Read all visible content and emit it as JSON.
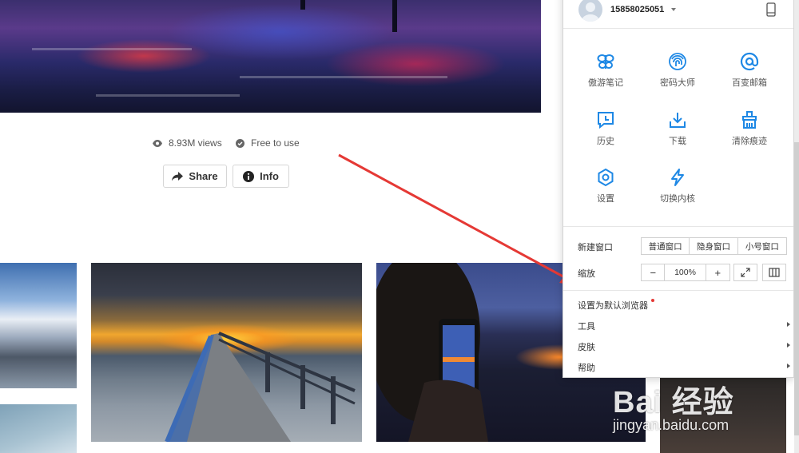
{
  "photo": {
    "views": "8.93M views",
    "license": "Free to use",
    "share_label": "Share",
    "info_label": "Info"
  },
  "browser_menu": {
    "username": "15858025051",
    "grid": [
      {
        "label": "傲游笔记",
        "icon": "butterfly-note-icon"
      },
      {
        "label": "密码大师",
        "icon": "fingerprint-icon"
      },
      {
        "label": "百变邮箱",
        "icon": "at-mail-icon"
      },
      {
        "label": "历史",
        "icon": "history-icon"
      },
      {
        "label": "下载",
        "icon": "download-icon"
      },
      {
        "label": "清除痕迹",
        "icon": "broom-icon"
      },
      {
        "label": "设置",
        "icon": "settings-gear-icon"
      },
      {
        "label": "切换内核",
        "icon": "lightning-icon"
      }
    ],
    "new_window": {
      "label": "新建窗口",
      "options": [
        "普通窗口",
        "隐身窗口",
        "小号窗口"
      ]
    },
    "zoom": {
      "label": "缩放",
      "minus": "−",
      "value": "100%",
      "plus": "+"
    },
    "list": [
      {
        "label": "设置为默认浏览器",
        "has_submenu": false
      },
      {
        "label": "工具",
        "has_submenu": true
      },
      {
        "label": "皮肤",
        "has_submenu": true
      },
      {
        "label": "帮助",
        "has_submenu": true
      }
    ]
  },
  "watermark": {
    "brand": "Bai 经验",
    "url": "jingyan.baidu.com"
  },
  "colors": {
    "accent_blue": "#1e88e5",
    "arrow_red": "#e53935"
  }
}
